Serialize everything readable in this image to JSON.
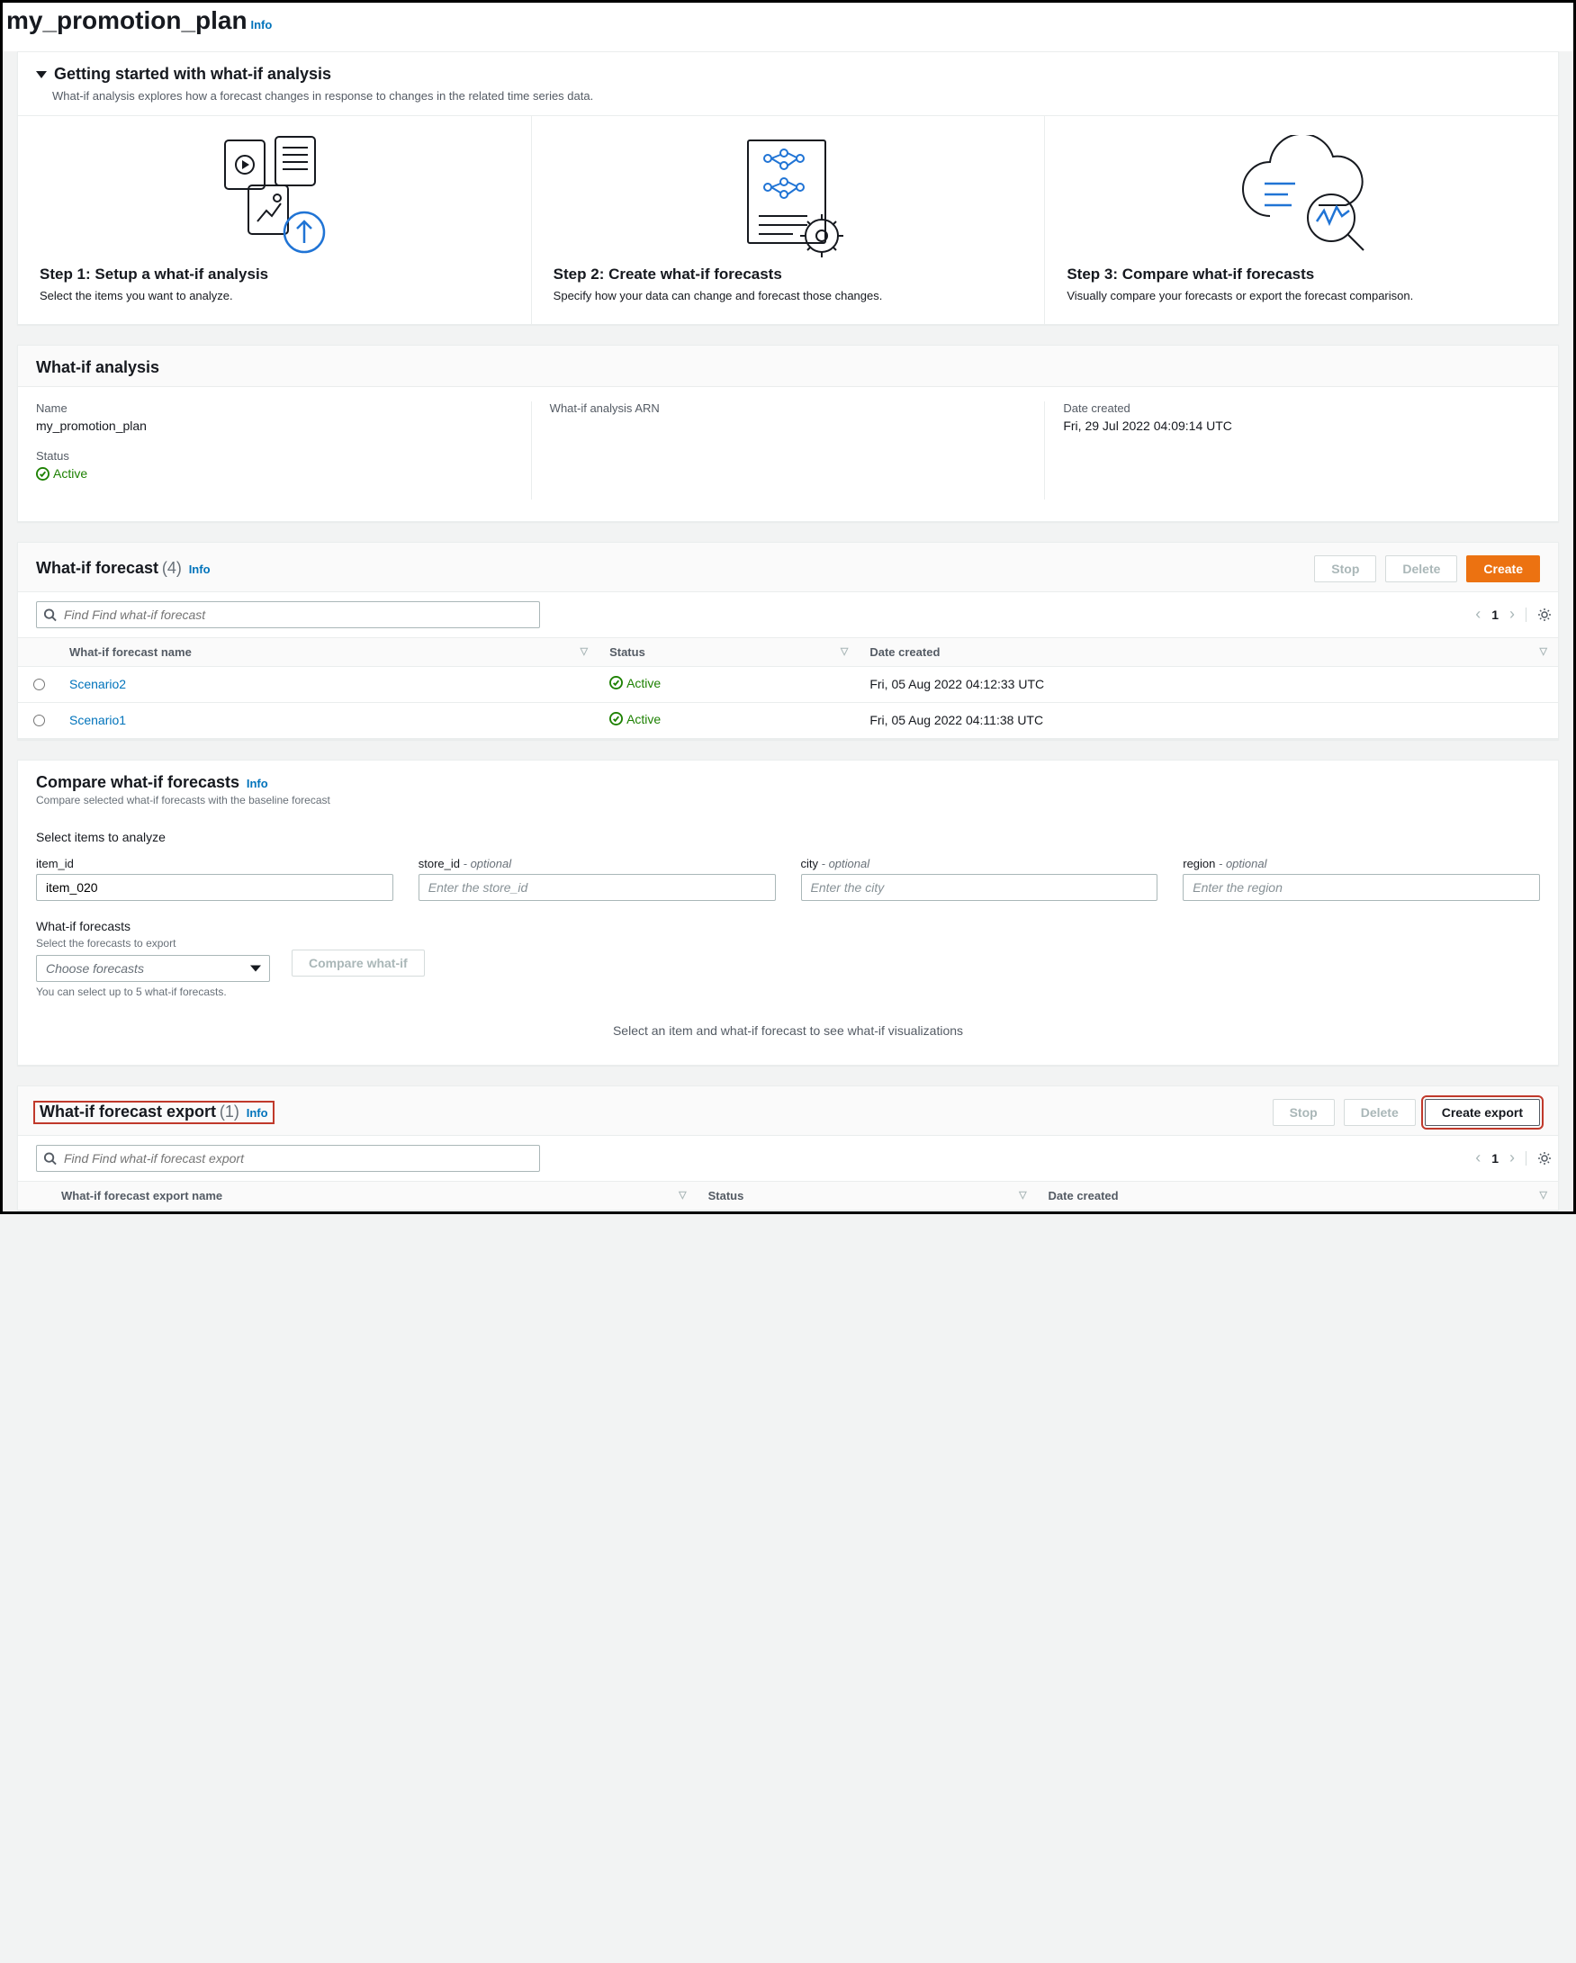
{
  "page": {
    "title": "my_promotion_plan",
    "info": "Info"
  },
  "getting_started": {
    "title": "Getting started with what-if analysis",
    "description": "What-if analysis explores how a forecast changes in response to changes in the related time series data.",
    "steps": [
      {
        "title": "Step 1: Setup a what-if analysis",
        "desc": "Select the items you want to analyze."
      },
      {
        "title": "Step 2: Create what-if forecasts",
        "desc": "Specify how your data can change and forecast those changes."
      },
      {
        "title": "Step 3: Compare what-if forecasts",
        "desc": "Visually compare your forecasts or export the forecast comparison."
      }
    ]
  },
  "analysis": {
    "header": "What-if analysis",
    "name_label": "Name",
    "name_value": "my_promotion_plan",
    "arn_label": "What-if analysis ARN",
    "arn_value": "",
    "date_label": "Date created",
    "date_value": "Fri, 29 Jul 2022 04:09:14 UTC",
    "status_label": "Status",
    "status_value": "Active"
  },
  "forecast": {
    "header": "What-if forecast",
    "count": "(4)",
    "info": "Info",
    "actions": {
      "stop": "Stop",
      "delete": "Delete",
      "create": "Create"
    },
    "search_placeholder": "Find Find what-if forecast",
    "page_number": "1",
    "columns": {
      "name": "What-if forecast name",
      "status": "Status",
      "date": "Date created"
    },
    "rows": [
      {
        "name": "Scenario2",
        "status": "Active",
        "date": "Fri, 05 Aug 2022 04:12:33 UTC"
      },
      {
        "name": "Scenario1",
        "status": "Active",
        "date": "Fri, 05 Aug 2022 04:11:38 UTC"
      }
    ]
  },
  "compare": {
    "header": "Compare what-if forecasts",
    "info": "Info",
    "subtitle": "Compare selected what-if forecasts with the baseline forecast",
    "select_items_label": "Select items to analyze",
    "fields": {
      "item_id": {
        "label": "item_id",
        "value": "item_020",
        "placeholder": ""
      },
      "store_id": {
        "label": "store_id",
        "opt": "- optional",
        "placeholder": "Enter the store_id"
      },
      "city": {
        "label": "city",
        "opt": "- optional",
        "placeholder": "Enter the city"
      },
      "region": {
        "label": "region",
        "opt": "- optional",
        "placeholder": "Enter the region"
      }
    },
    "forecasts_label": "What-if forecasts",
    "forecasts_sub": "Select the forecasts to export",
    "forecasts_placeholder": "Choose forecasts",
    "forecasts_hint": "You can select up to 5 what-if forecasts.",
    "compare_button": "Compare what-if",
    "viz_placeholder": "Select an item and what-if forecast to see what-if visualizations"
  },
  "export": {
    "header": "What-if forecast export",
    "count": "(1)",
    "info": "Info",
    "actions": {
      "stop": "Stop",
      "delete": "Delete",
      "create": "Create export"
    },
    "search_placeholder": "Find Find what-if forecast export",
    "page_number": "1",
    "columns": {
      "name": "What-if forecast export name",
      "status": "Status",
      "date": "Date created"
    }
  }
}
